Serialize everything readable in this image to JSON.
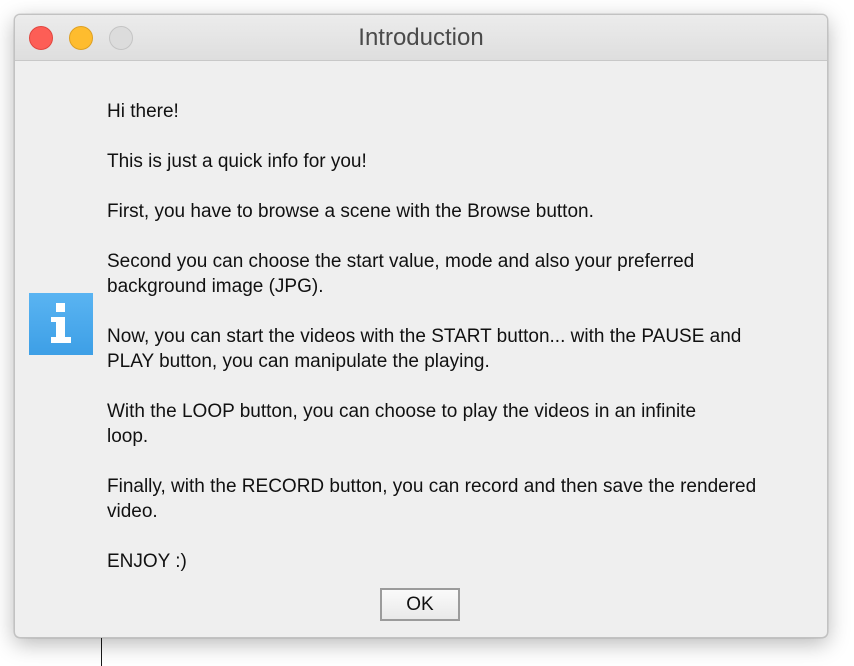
{
  "window": {
    "title": "Introduction"
  },
  "message": {
    "paragraphs": [
      "Hi there!",
      "This is just a quick info for you!",
      "First, you have to browse a scene with the Browse button.",
      "Second you can choose the start value, mode and also your preferred\nbackground image (JPG).",
      "Now, you can start the videos with the START button... with the PAUSE and\nPLAY button, you can manipulate the playing.",
      "With the LOOP button, you can choose to play the videos in an infinite\nloop.",
      "Finally, with the RECORD button, you can record and then save the rendered\nvideo.",
      "ENJOY :)"
    ]
  },
  "buttons": {
    "ok_label": "OK"
  },
  "icons": {
    "dialog": "info-icon",
    "traffic_lights": [
      "close-icon",
      "minimize-icon",
      "zoom-icon"
    ]
  },
  "colors": {
    "close": "#fd5e56",
    "minimize": "#febc2e",
    "zoom_disabled": "#dcdcdc",
    "info_icon": "#4aa8ec",
    "window_bg": "#efefef"
  }
}
